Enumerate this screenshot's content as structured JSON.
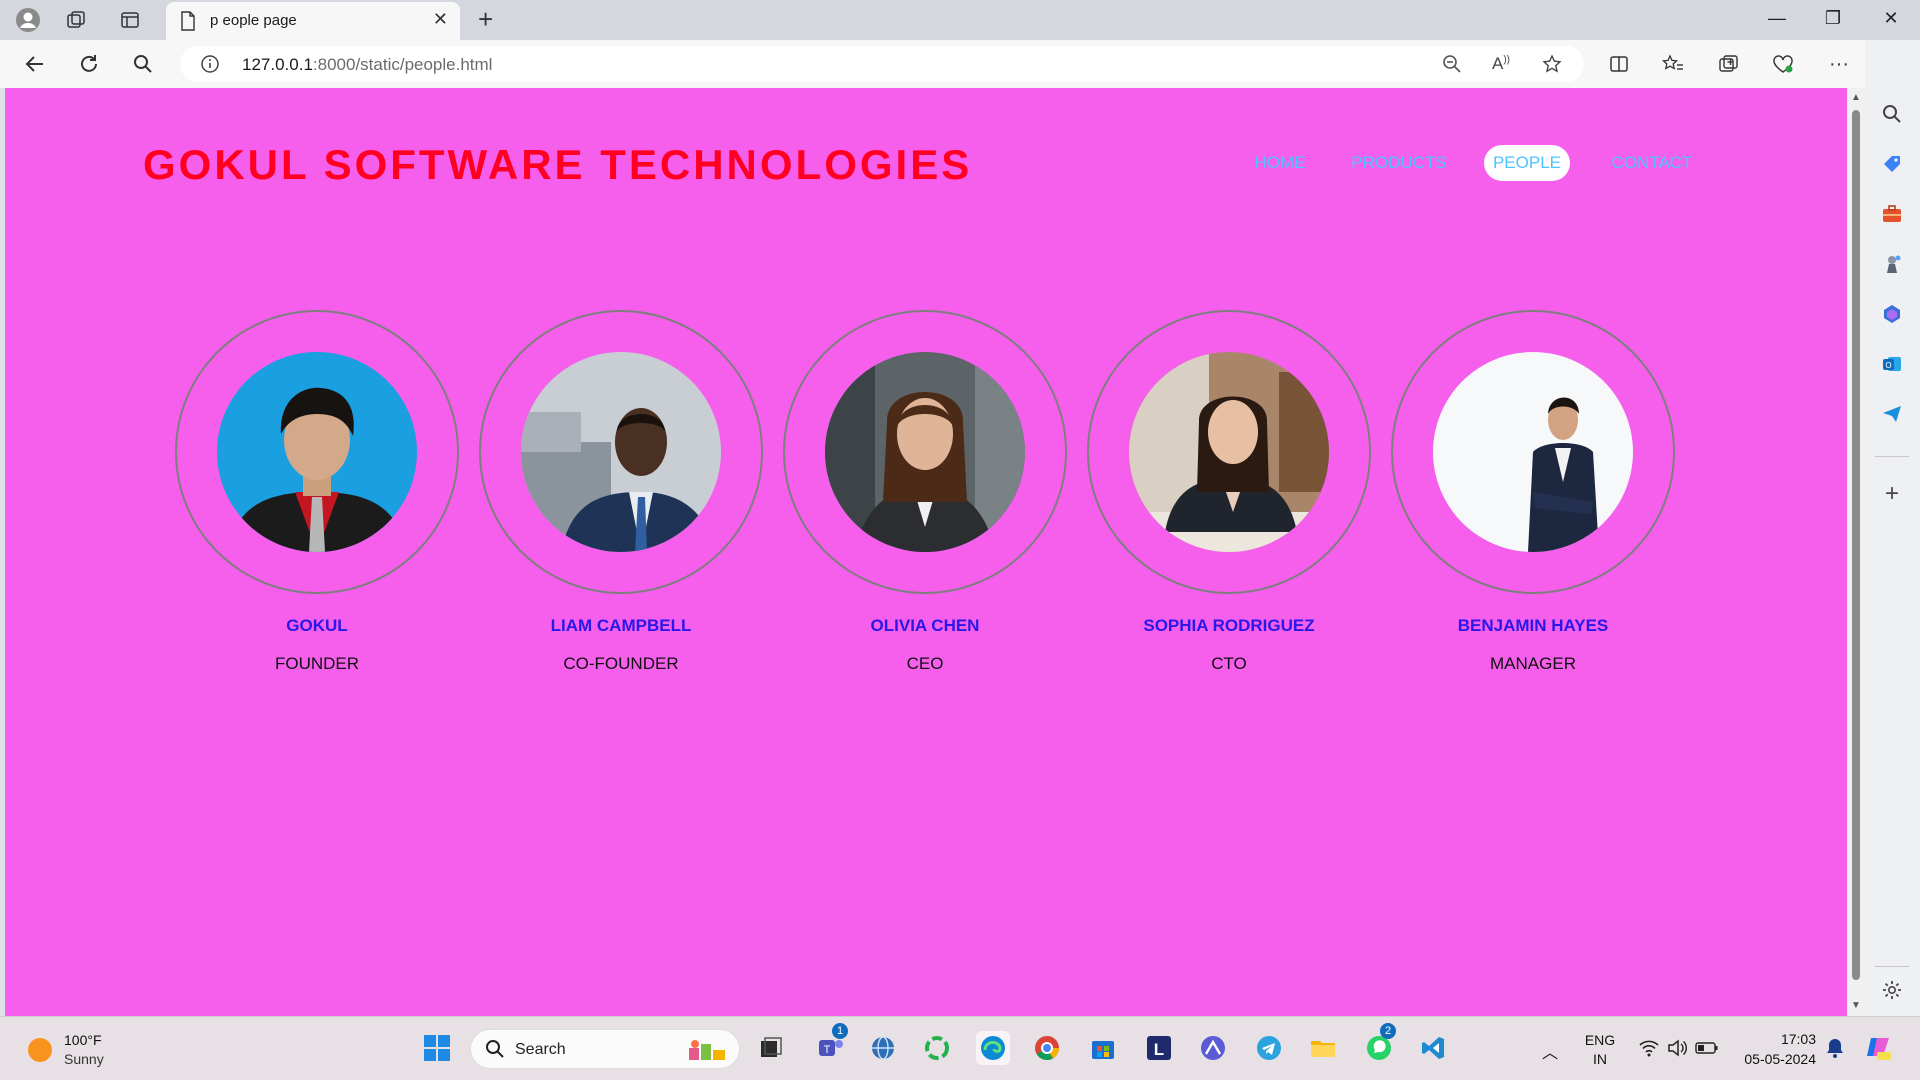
{
  "browser": {
    "tab_title": "p eople page",
    "url_host": "127.0.0.1",
    "url_path": ":8000/static/people.html"
  },
  "page": {
    "brand": "GOKUL SOFTWARE TECHNOLOGIES",
    "nav": [
      {
        "label": "HOME"
      },
      {
        "label": "PRODUCTS"
      },
      {
        "label": "PEOPLE",
        "active": true
      },
      {
        "label": "CONTACT"
      }
    ],
    "people": [
      {
        "name": "GOKUL",
        "role": "FOUNDER"
      },
      {
        "name": "LIAM CAMPBELL",
        "role": "CO-FOUNDER"
      },
      {
        "name": "OLIVIA CHEN",
        "role": "CEO"
      },
      {
        "name": "SOPHIA RODRIGUEZ",
        "role": "CTO"
      },
      {
        "name": "BENJAMIN HAYES",
        "role": "MANAGER"
      }
    ],
    "colors": {
      "background": "#f55fec",
      "brand": "#ff0022",
      "nav_link": "#4dc3ff",
      "person_name": "#2a18e8"
    }
  },
  "taskbar": {
    "weather_temp": "100°F",
    "weather_cond": "Sunny",
    "search_label": "Search",
    "teams_badge": "1",
    "whatsapp_badge": "2",
    "lang_1": "ENG",
    "lang_2": "IN",
    "time": "17:03",
    "date": "05-05-2024"
  }
}
